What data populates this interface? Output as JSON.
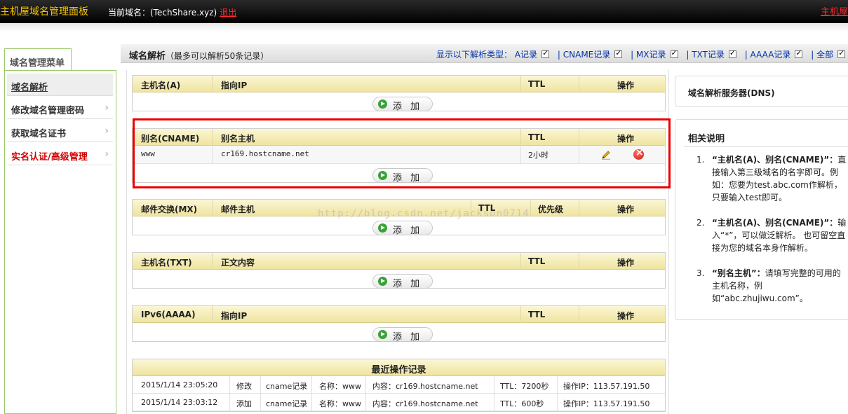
{
  "topbar": {
    "brand": "主机屋域名管理面板",
    "current_domain": "当前域名：(TechShare.xyz)",
    "logout": "退出",
    "brand_right": "主机屋"
  },
  "sidebar": {
    "tab_label": "域名管理菜单",
    "items": [
      {
        "label": "域名解析"
      },
      {
        "label": "修改域名管理密码"
      },
      {
        "label": "获取域名证书"
      },
      {
        "label": "实名认证/高级管理"
      }
    ]
  },
  "main": {
    "title": "域名解析",
    "title_note": "（最多可以解析50条记录）",
    "filter_label": "显示以下解析类型：",
    "filters": [
      "A记录",
      "| CNAME记录",
      "| MX记录",
      "| TXT记录",
      "| AAAA记录",
      "| 全部"
    ]
  },
  "add_label": "添 加",
  "tables": {
    "a": {
      "c1": "主机名(A)",
      "c2": "指向IP",
      "c3": "TTL",
      "c4": "操作"
    },
    "cname": {
      "c1": "别名(CNAME)",
      "c2": "别名主机",
      "c3": "TTL",
      "c4": "操作",
      "rows": [
        {
          "name": "www",
          "host": "cr169.hostcname.net",
          "ttl": "2小时"
        }
      ]
    },
    "mx": {
      "c1": "邮件交换(MX)",
      "c2": "邮件主机",
      "c3": "TTL",
      "c4": "优先级",
      "c5": "操作"
    },
    "txt": {
      "c1": "主机名(TXT)",
      "c2": "正文内容",
      "c3": "TTL",
      "c4": "操作"
    },
    "aaaa": {
      "c1": "IPv6(AAAA)",
      "c2": "指向IP",
      "c3": "TTL",
      "c4": "操作"
    }
  },
  "watermark": "http://blog.csdn.net/jackson0714",
  "log": {
    "title": "最近操作记录",
    "rows": [
      {
        "time": "2015/1/14 23:05:20",
        "action": "修改",
        "type": "cname记录",
        "name": "名称：www",
        "content": "内容：cr169.hostcname.net",
        "ttl": "TTL：7200秒",
        "ip": "操作IP：113.57.191.50"
      },
      {
        "time": "2015/1/14 23:03:12",
        "action": "添加",
        "type": "cname记录",
        "name": "名称：www",
        "content": "内容：cr169.hostcname.net",
        "ttl": "TTL：600秒",
        "ip": "操作IP：113.57.191.50"
      }
    ]
  },
  "right": {
    "dns_title": "域名解析服务器(DNS)",
    "help_title": "相关说明",
    "help": [
      {
        "num": "1.",
        "bold": "“主机名(A)、别名(CNAME)”：",
        "text": "直接输入第三级域名的名字即可。例如：您要为test.abc.com作解析，只要输入test即可。"
      },
      {
        "num": "2.",
        "bold": "“主机名(A)、别名(CNAME)”：",
        "text": "输入“*”，可以做泛解析。 也可留空直接为您的域名本身作解析。"
      },
      {
        "num": "3.",
        "bold": "“别名主机”：",
        "text": "请填写完整的可用的主机名称，例如“abc.zhujiwu.com”。"
      }
    ]
  }
}
